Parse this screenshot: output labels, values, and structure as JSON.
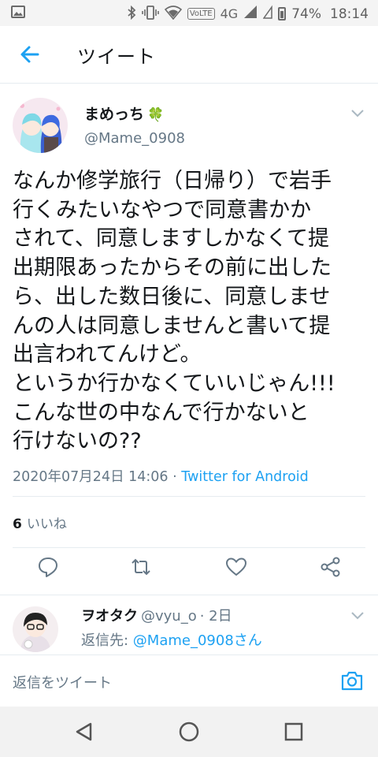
{
  "status_bar": {
    "battery": "74%",
    "time": "18:14",
    "network": "4G",
    "volte": "VoLTE",
    "icons": [
      "image-icon",
      "bluetooth-icon",
      "vibrate-icon",
      "wifi-icon",
      "signal-icon",
      "battery-icon"
    ]
  },
  "header": {
    "title": "ツイート",
    "back_icon": "arrow-left-icon"
  },
  "tweet": {
    "display_name": "まめっち",
    "name_emoji": "🍀",
    "handle": "@Mame_0908",
    "text": "なんか修学旅行（日帰り）で岩手\n行くみたいなやつで同意書かか\nされて、同意しますしかなくて提\n出期限あったからその前に出した\nら、出した数日後に、同意しませ\nんの人は同意しませんと書いて提\n出言われてんけど。\nというか行かなくていいじゃん!!!\nこんな世の中なんで行かないと\n行けないの??",
    "timestamp": "2020年07月24日 14:06",
    "separator": " · ",
    "source": "Twitter for Android",
    "likes_count": "6",
    "likes_label": "いいね"
  },
  "actions": [
    "reply-icon",
    "retweet-icon",
    "like-icon",
    "share-icon"
  ],
  "reply": {
    "display_name": "ヲオタク",
    "handle": "@vyu_o",
    "age": "· 2日",
    "reply_to_label": "返信先: ",
    "reply_to_mention": "@Mame_0908さん"
  },
  "compose": {
    "placeholder": "返信をツイート",
    "camera_icon": "camera-icon"
  },
  "nav_bar": [
    "back-triangle-icon",
    "home-circle-icon",
    "recents-square-icon"
  ],
  "colors": {
    "accent": "#1da1f2",
    "secondary_text": "#657786",
    "primary_text": "#14171a",
    "divider": "#e6ecf0"
  }
}
